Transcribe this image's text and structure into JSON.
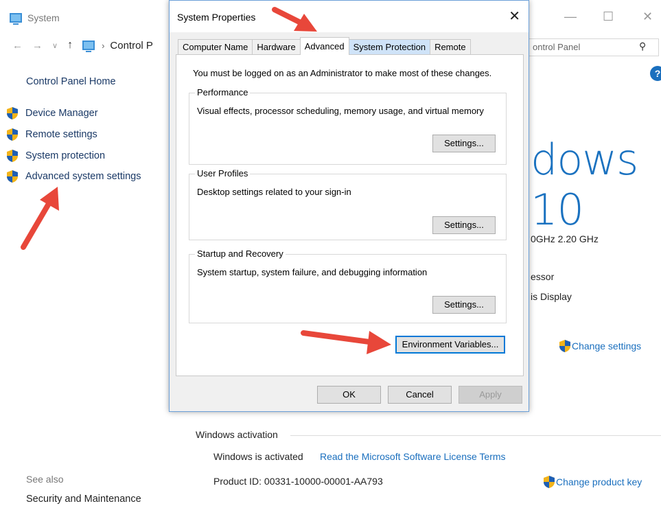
{
  "background": {
    "window_title": "System",
    "breadcrumb": "Control P",
    "search_placeholder": "ontrol Panel",
    "help_icon": "?",
    "sidebar": {
      "home": "Control Panel Home",
      "items": [
        {
          "label": "Device Manager"
        },
        {
          "label": "Remote settings"
        },
        {
          "label": "System protection"
        },
        {
          "label": "Advanced system settings"
        }
      ],
      "see_also_label": "See also",
      "see_also_link": "Security and Maintenance"
    },
    "edition_text": "dows 10",
    "processor_text": "0GHz  2.20 GHz",
    "processor_partial": "essor",
    "display_partial": "is Display",
    "change_settings": "Change settings",
    "activation": {
      "heading": "Windows activation",
      "status": "Windows is activated",
      "license_link": "Read the Microsoft Software License Terms",
      "product_id": "Product ID:  00331-10000-00001-AA793",
      "change_product_key": "Change product key"
    }
  },
  "dialog": {
    "title": "System Properties",
    "close_glyph": "✕",
    "tabs": [
      {
        "label": "Computer Name"
      },
      {
        "label": "Hardware"
      },
      {
        "label": "Advanced"
      },
      {
        "label": "System Protection"
      },
      {
        "label": "Remote"
      }
    ],
    "admin_note": "You must be logged on as an Administrator to make most of these changes.",
    "performance": {
      "label": "Performance",
      "description": "Visual effects, processor scheduling, memory usage, and virtual memory",
      "button": "Settings..."
    },
    "user_profiles": {
      "label": "User Profiles",
      "description": "Desktop settings related to your sign-in",
      "button": "Settings..."
    },
    "startup_recovery": {
      "label": "Startup and Recovery",
      "description": "System startup, system failure, and debugging information",
      "button": "Settings..."
    },
    "env_button": "Environment Variables...",
    "ok": "OK",
    "cancel": "Cancel",
    "apply": "Apply"
  },
  "colors": {
    "annotation_arrow": "#e8473a",
    "link": "#1a6fbe",
    "accent": "#1b72c0"
  }
}
